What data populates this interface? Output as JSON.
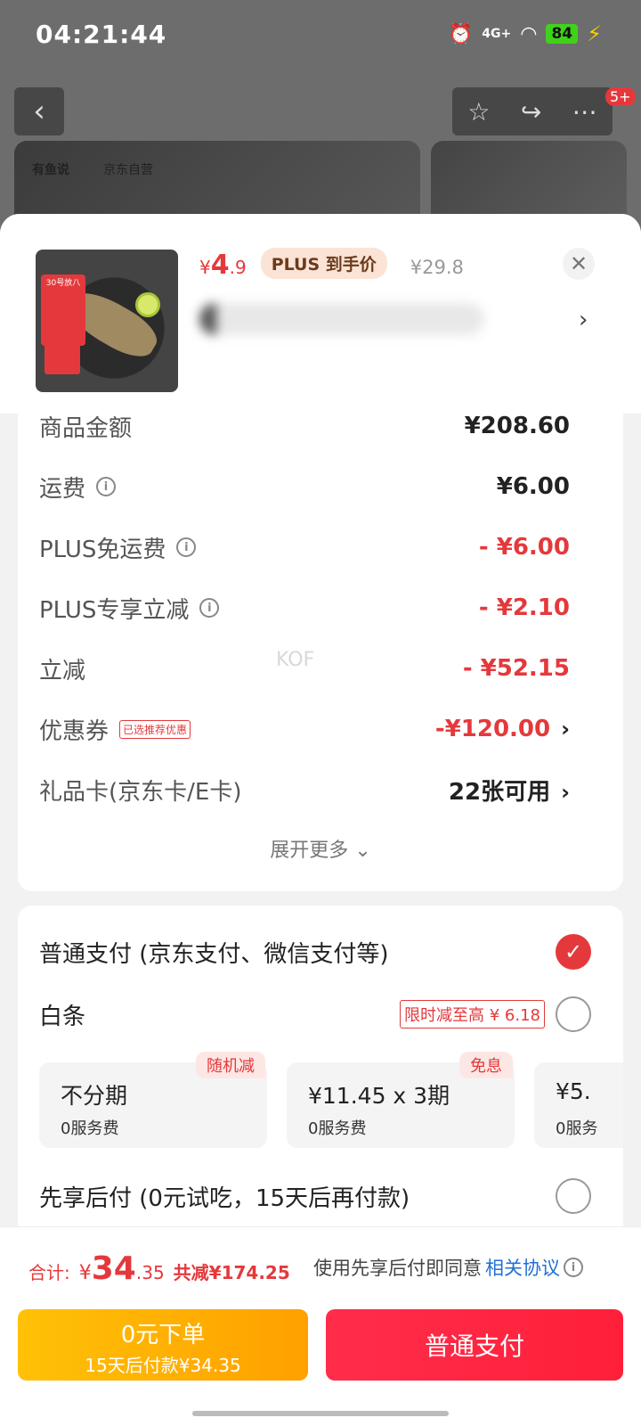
{
  "status": {
    "time": "04:21:44",
    "network": "4G+",
    "battery": "84"
  },
  "background": {
    "brand_text": "有鱼说",
    "brand_self": "京东自营",
    "badge": "5+"
  },
  "product": {
    "price_yen": "¥",
    "price_int": "4",
    "price_dec": ".9",
    "plus_badge": "PLUS 到手价",
    "original_price": "¥29.8",
    "thumb_tag": "30号放八"
  },
  "fees": [
    {
      "label": "商品金额",
      "value": "¥208.60",
      "info": false,
      "red": false
    },
    {
      "label": "运费",
      "value": "¥6.00",
      "info": true,
      "red": false
    },
    {
      "label": "PLUS免运费",
      "value": "- ¥6.00",
      "info": true,
      "red": true
    },
    {
      "label": "PLUS专享立减",
      "value": "- ¥2.10",
      "info": true,
      "red": true
    },
    {
      "label": "立减",
      "value": "- ¥52.15",
      "info": false,
      "red": true
    },
    {
      "label": "优惠券",
      "value": "-¥120.00",
      "tag": "已选推荐优惠",
      "red": true
    },
    {
      "label": "礼品卡(京东卡/E卡)",
      "value": "22张可用",
      "red": false
    }
  ],
  "expand_label": "展开更多",
  "watermark": "KOF",
  "payment": {
    "normal_label": "普通支付 (京东支付、微信支付等)",
    "baitiao_label": "白条",
    "baitiao_tag": "限时减至高 ¥ 6.18",
    "plans": [
      {
        "title": "不分期",
        "sub": "0服务费",
        "tag": "随机减"
      },
      {
        "title": "¥11.45 x 3期",
        "sub": "0服务费",
        "tag": "免息"
      },
      {
        "title": "¥5.",
        "sub": "0服务",
        "tag": ""
      }
    ],
    "later_label": "先享后付 (0元试吃，15天后再付款)"
  },
  "bottom": {
    "total_label": "合计:",
    "total_yen": "¥",
    "total_int": "34",
    "total_dec": ".35",
    "total_saved": "共减¥174.25",
    "agree_text": "使用先享后付即同意",
    "agree_link": "相关协议",
    "pay_later_l1": "0元下单",
    "pay_later_l2": "15天后付款¥34.35",
    "pay_now": "普通支付"
  }
}
